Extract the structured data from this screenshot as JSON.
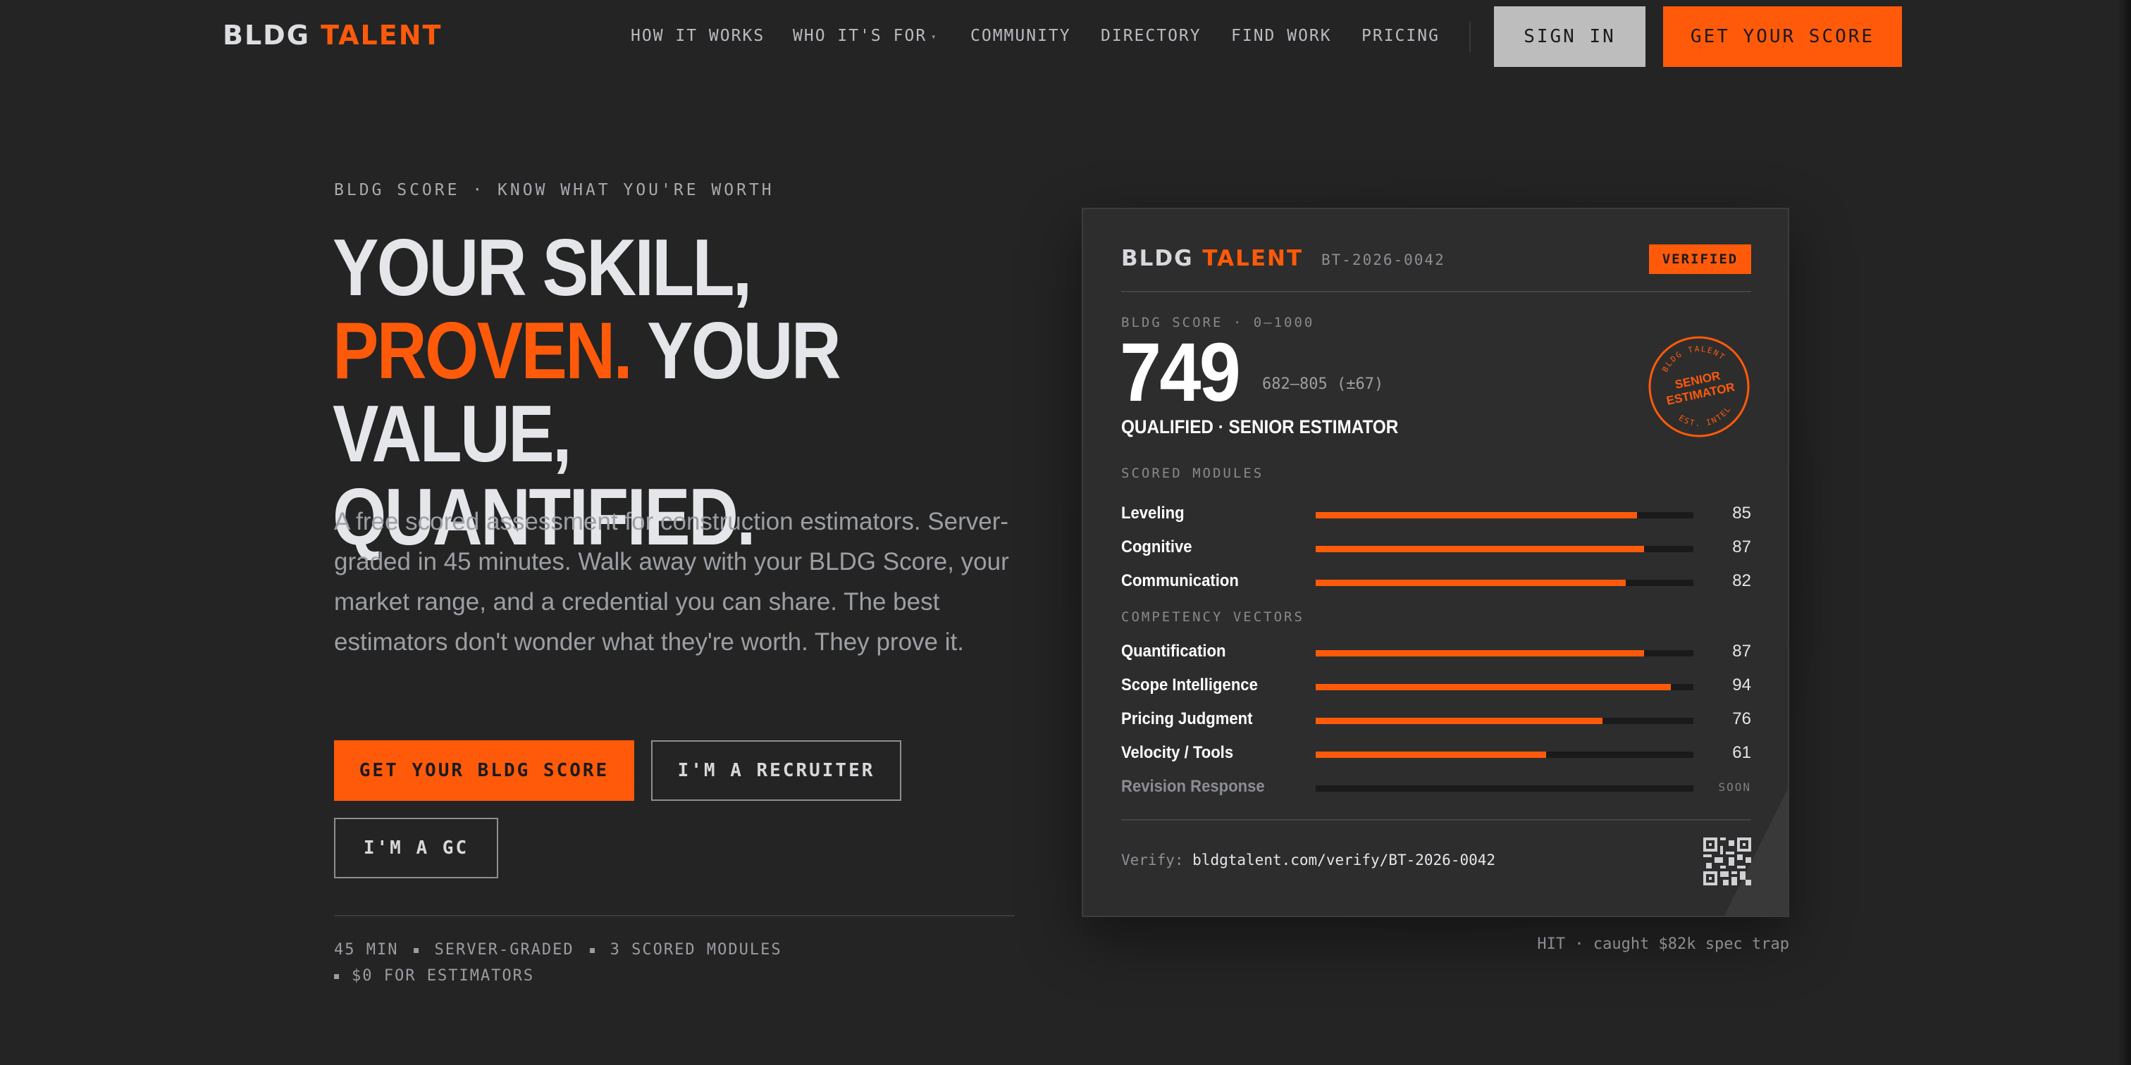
{
  "nav": {
    "logo_main": "BLDG",
    "logo_accent": "TALENT",
    "links": [
      {
        "label": "HOW IT WORKS"
      },
      {
        "label": "WHO IT'S FOR",
        "has_dropdown": true
      },
      {
        "label": "COMMUNITY"
      },
      {
        "label": "DIRECTORY"
      },
      {
        "label": "FIND WORK"
      },
      {
        "label": "PRICING"
      }
    ],
    "dropdown_caret": "▾",
    "sign_in": "SIGN IN",
    "get_score": "GET YOUR SCORE"
  },
  "hero": {
    "eyebrow": "BLDG SCORE · KNOW WHAT YOU'RE WORTH",
    "headline_line1": "YOUR SKILL,",
    "headline_accent": "PROVEN.",
    "headline_line2_rest": " YOUR",
    "headline_line3": "VALUE, QUANTIFIED.",
    "lede": "A free scored assessment for construction estimators. Server-graded in 45 minutes. Walk away with your BLDG Score, your market range, and a credential you can share. The best estimators don't wonder what they're worth. They prove it.",
    "cta_primary": "GET YOUR BLDG SCORE",
    "cta_recruiter": "I'M A RECRUITER",
    "cta_gc": "I'M A GC",
    "meta": [
      "45 MIN",
      "SERVER-GRADED",
      "3 SCORED MODULES",
      "$0 FOR ESTIMATORS"
    ]
  },
  "card": {
    "logo_main": "BLDG",
    "logo_accent": "TALENT",
    "id": "BT-2026-0042",
    "badge": "VERIFIED",
    "score_eyebrow": "BLDG SCORE · 0–1000",
    "score": "749",
    "range": "682–805 (±67)",
    "qualification": "QUALIFIED · SENIOR ESTIMATOR",
    "seal": {
      "top": "BLDG TALENT",
      "line1": "SENIOR",
      "line2": "ESTIMATOR",
      "bottom": "EST. INTEL"
    },
    "modules_eyebrow": "SCORED MODULES",
    "modules": [
      {
        "label": "Leveling",
        "value": 85
      },
      {
        "label": "Cognitive",
        "value": 87
      },
      {
        "label": "Communication",
        "value": 82
      }
    ],
    "vectors_eyebrow": "COMPETENCY VECTORS",
    "vectors": [
      {
        "label": "Quantification",
        "value": 87
      },
      {
        "label": "Scope Intelligence",
        "value": 94
      },
      {
        "label": "Pricing Judgment",
        "value": 76
      },
      {
        "label": "Velocity / Tools",
        "value": 61
      }
    ],
    "pending": {
      "label": "Revision Response",
      "status": "SOON"
    },
    "verify_label": "Verify:",
    "verify_url": "bldgtalent.com/verify/BT-2026-0042"
  },
  "below_card": "HIT · caught $82k spec trap",
  "colors": {
    "accent": "#ff5a0a",
    "background": "#242424",
    "card": "#2d2d2d",
    "track": "#1a1a1a"
  }
}
